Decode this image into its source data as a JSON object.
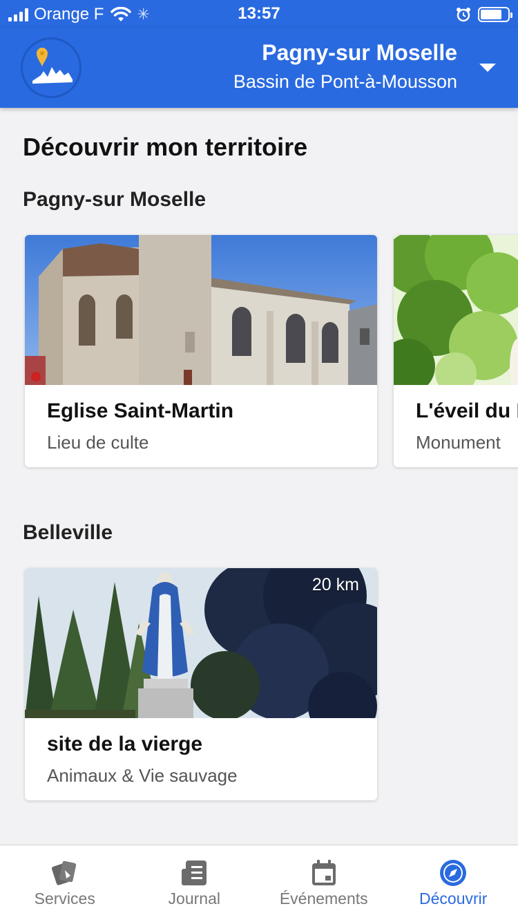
{
  "status_bar": {
    "carrier": "Orange F",
    "time": "13:57"
  },
  "header": {
    "town_name": "Pagny-sur Moselle",
    "area_name": "Bassin de Pont-à-Mousson"
  },
  "page": {
    "title": "Découvrir mon territoire"
  },
  "sections": [
    {
      "title": "Pagny-sur Moselle",
      "cards": [
        {
          "title": "Eglise Saint-Martin",
          "subtitle": "Lieu de culte"
        },
        {
          "title": "L'éveil du P",
          "subtitle": "Monument"
        }
      ]
    },
    {
      "title": "Belleville",
      "cards": [
        {
          "title": "site de la vierge",
          "subtitle": "Animaux & Vie sauvage",
          "distance": "20 km"
        }
      ]
    }
  ],
  "tabbar": {
    "items": [
      {
        "label": "Services",
        "icon": "services-icon",
        "active": false
      },
      {
        "label": "Journal",
        "icon": "journal-icon",
        "active": false
      },
      {
        "label": "Événements",
        "icon": "calendar-icon",
        "active": false
      },
      {
        "label": "Découvrir",
        "icon": "compass-icon",
        "active": true
      }
    ]
  },
  "colors": {
    "primary": "#2a6ae0",
    "tab_inactive": "#777777",
    "background": "#f2f2f4"
  }
}
